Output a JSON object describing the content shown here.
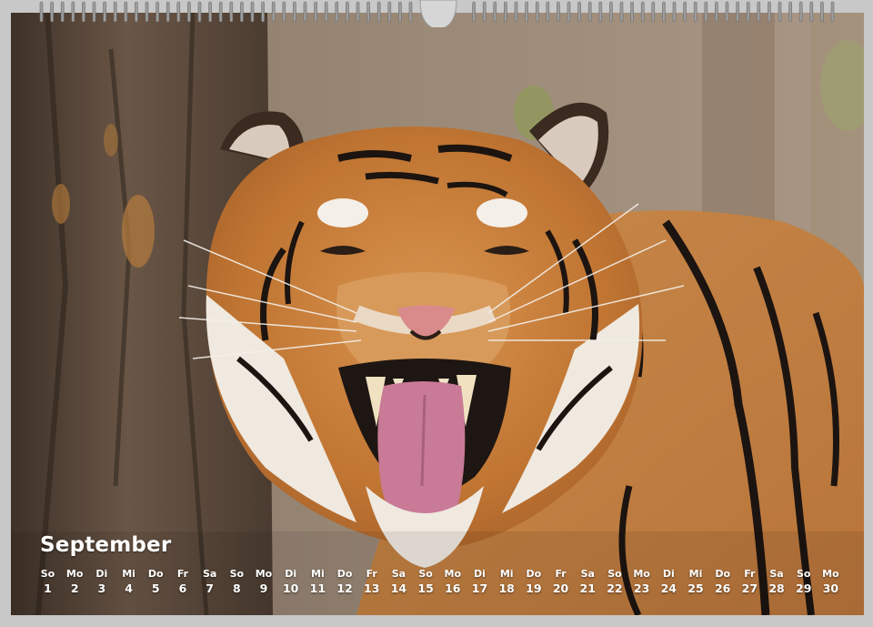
{
  "calendar": {
    "month": "September",
    "days": [
      {
        "weekday": "So",
        "date": "1"
      },
      {
        "weekday": "Mo",
        "date": "2"
      },
      {
        "weekday": "Di",
        "date": "3"
      },
      {
        "weekday": "Mi",
        "date": "4"
      },
      {
        "weekday": "Do",
        "date": "5"
      },
      {
        "weekday": "Fr",
        "date": "6"
      },
      {
        "weekday": "Sa",
        "date": "7"
      },
      {
        "weekday": "So",
        "date": "8"
      },
      {
        "weekday": "Mo",
        "date": "9"
      },
      {
        "weekday": "Di",
        "date": "10"
      },
      {
        "weekday": "Mi",
        "date": "11"
      },
      {
        "weekday": "Do",
        "date": "12"
      },
      {
        "weekday": "Fr",
        "date": "13"
      },
      {
        "weekday": "Sa",
        "date": "14"
      },
      {
        "weekday": "So",
        "date": "15"
      },
      {
        "weekday": "Mo",
        "date": "16"
      },
      {
        "weekday": "Di",
        "date": "17"
      },
      {
        "weekday": "Mi",
        "date": "18"
      },
      {
        "weekday": "Do",
        "date": "19"
      },
      {
        "weekday": "Fr",
        "date": "20"
      },
      {
        "weekday": "Sa",
        "date": "21"
      },
      {
        "weekday": "So",
        "date": "22"
      },
      {
        "weekday": "Mo",
        "date": "23"
      },
      {
        "weekday": "Di",
        "date": "24"
      },
      {
        "weekday": "Mi",
        "date": "25"
      },
      {
        "weekday": "Do",
        "date": "26"
      },
      {
        "weekday": "Fr",
        "date": "27"
      },
      {
        "weekday": "Sa",
        "date": "28"
      },
      {
        "weekday": "So",
        "date": "29"
      },
      {
        "weekday": "Mo",
        "date": "30"
      }
    ]
  },
  "photo": {
    "subject": "tiger-snarling-icon"
  },
  "colors": {
    "page": "#c8c8c8",
    "text": "#ffffff",
    "fur": "#c9823e",
    "stripe": "#1c1410",
    "bark": "#5b4a3c"
  }
}
